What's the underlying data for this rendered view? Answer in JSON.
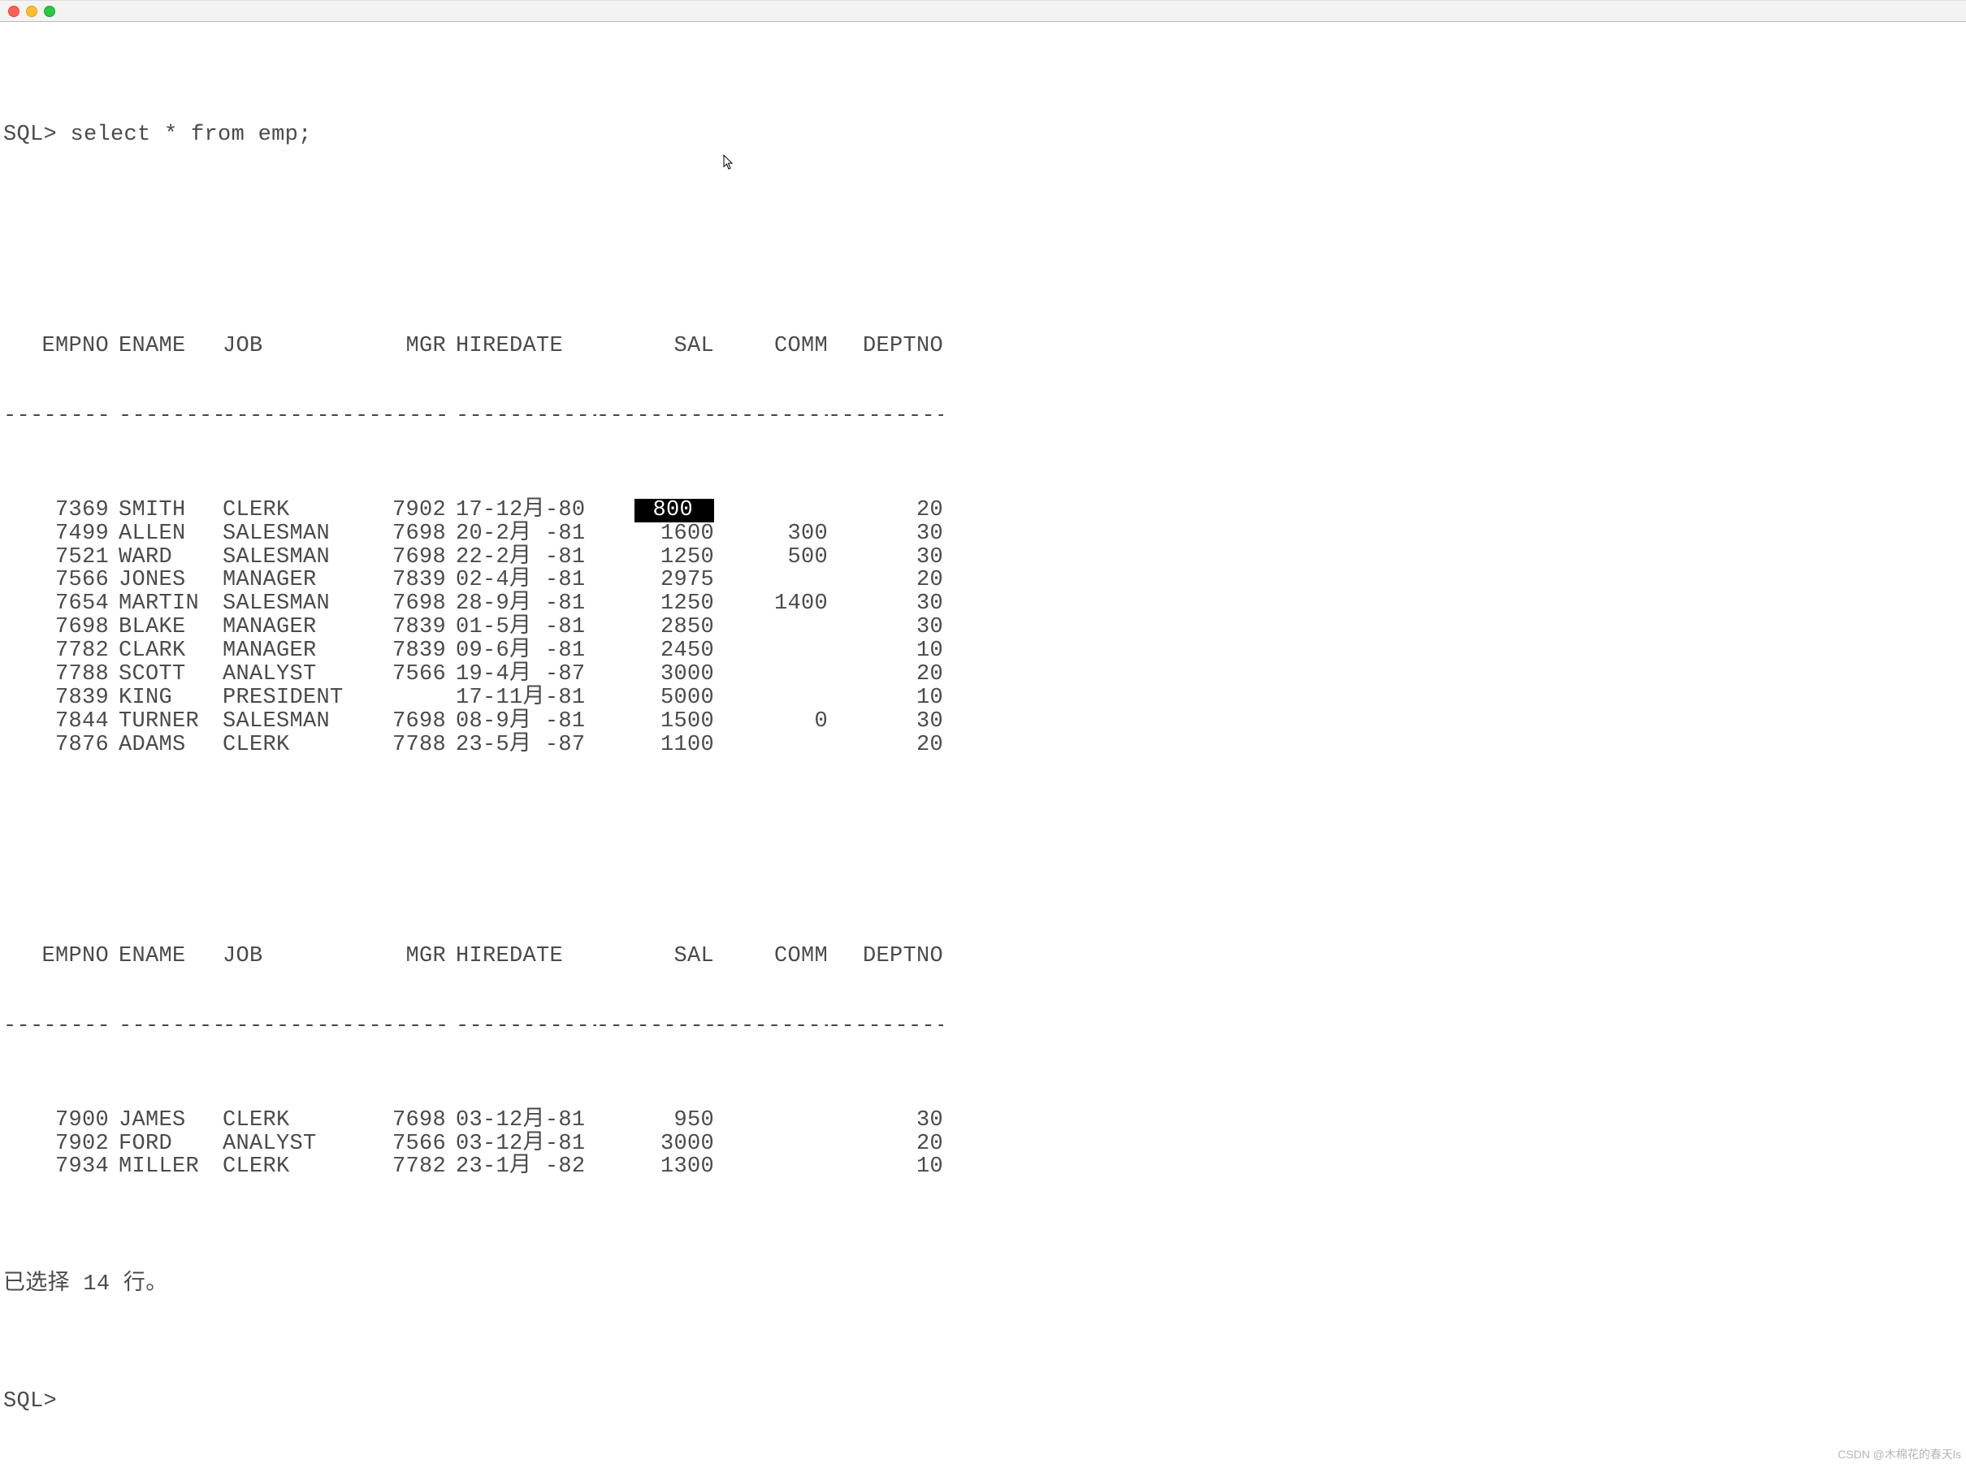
{
  "window": {
    "traffic_lights": [
      "red",
      "yellow",
      "green"
    ]
  },
  "prompt_prefix": "SQL>",
  "query": "select * from emp;",
  "headers": {
    "empno": "EMPNO",
    "ename": "ENAME",
    "job": "JOB",
    "mgr": "MGR",
    "hiredate": "HIREDATE",
    "sal": "SAL",
    "comm": "COMM",
    "deptno": "DEPTNO"
  },
  "sep": {
    "empno": "----------",
    "ename": "----------",
    "job": "---------",
    "mgr": "----------",
    "hiredate": "--------------",
    "sal": "----------",
    "comm": "----------",
    "deptno": "----------"
  },
  "rows_page1": [
    {
      "empno": "7369",
      "ename": "SMITH",
      "job": "CLERK",
      "mgr": "7902",
      "hiredate": "17-12月-80",
      "sal": "800",
      "comm": "",
      "deptno": "20",
      "sal_highlight": true
    },
    {
      "empno": "7499",
      "ename": "ALLEN",
      "job": "SALESMAN",
      "mgr": "7698",
      "hiredate": "20-2月 -81",
      "sal": "1600",
      "comm": "300",
      "deptno": "30"
    },
    {
      "empno": "7521",
      "ename": "WARD",
      "job": "SALESMAN",
      "mgr": "7698",
      "hiredate": "22-2月 -81",
      "sal": "1250",
      "comm": "500",
      "deptno": "30"
    },
    {
      "empno": "7566",
      "ename": "JONES",
      "job": "MANAGER",
      "mgr": "7839",
      "hiredate": "02-4月 -81",
      "sal": "2975",
      "comm": "",
      "deptno": "20"
    },
    {
      "empno": "7654",
      "ename": "MARTIN",
      "job": "SALESMAN",
      "mgr": "7698",
      "hiredate": "28-9月 -81",
      "sal": "1250",
      "comm": "1400",
      "deptno": "30"
    },
    {
      "empno": "7698",
      "ename": "BLAKE",
      "job": "MANAGER",
      "mgr": "7839",
      "hiredate": "01-5月 -81",
      "sal": "2850",
      "comm": "",
      "deptno": "30"
    },
    {
      "empno": "7782",
      "ename": "CLARK",
      "job": "MANAGER",
      "mgr": "7839",
      "hiredate": "09-6月 -81",
      "sal": "2450",
      "comm": "",
      "deptno": "10"
    },
    {
      "empno": "7788",
      "ename": "SCOTT",
      "job": "ANALYST",
      "mgr": "7566",
      "hiredate": "19-4月 -87",
      "sal": "3000",
      "comm": "",
      "deptno": "20"
    },
    {
      "empno": "7839",
      "ename": "KING",
      "job": "PRESIDENT",
      "mgr": "",
      "hiredate": "17-11月-81",
      "sal": "5000",
      "comm": "",
      "deptno": "10"
    },
    {
      "empno": "7844",
      "ename": "TURNER",
      "job": "SALESMAN",
      "mgr": "7698",
      "hiredate": "08-9月 -81",
      "sal": "1500",
      "comm": "0",
      "deptno": "30"
    },
    {
      "empno": "7876",
      "ename": "ADAMS",
      "job": "CLERK",
      "mgr": "7788",
      "hiredate": "23-5月 -87",
      "sal": "1100",
      "comm": "",
      "deptno": "20"
    }
  ],
  "rows_page2": [
    {
      "empno": "7900",
      "ename": "JAMES",
      "job": "CLERK",
      "mgr": "7698",
      "hiredate": "03-12月-81",
      "sal": "950",
      "comm": "",
      "deptno": "30"
    },
    {
      "empno": "7902",
      "ename": "FORD",
      "job": "ANALYST",
      "mgr": "7566",
      "hiredate": "03-12月-81",
      "sal": "3000",
      "comm": "",
      "deptno": "20"
    },
    {
      "empno": "7934",
      "ename": "MILLER",
      "job": "CLERK",
      "mgr": "7782",
      "hiredate": "23-1月 -82",
      "sal": "1300",
      "comm": "",
      "deptno": "10"
    }
  ],
  "footer": "已选择 14 行。",
  "watermark": "CSDN @木棉花的春天ls"
}
